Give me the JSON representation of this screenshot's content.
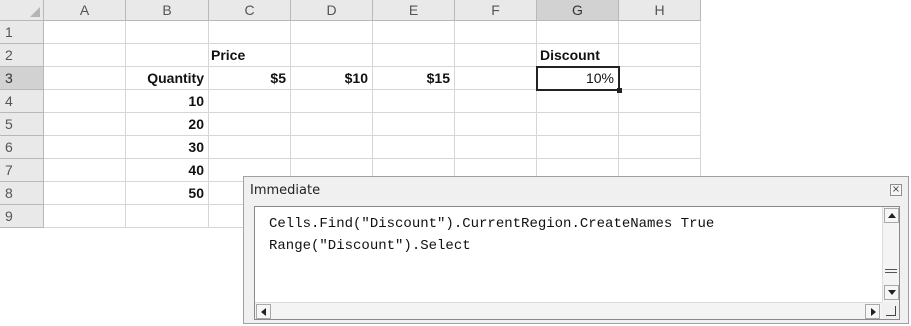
{
  "spreadsheet": {
    "column_headers": [
      "A",
      "B",
      "C",
      "D",
      "E",
      "F",
      "G",
      "H"
    ],
    "row_headers": [
      "1",
      "2",
      "3",
      "4",
      "5",
      "6",
      "7",
      "8",
      "9"
    ],
    "selected_column": "G",
    "selected_row": "3",
    "cells": {
      "C2": "Price",
      "G2": "Discount",
      "B3": "Quantity",
      "C3": "$5",
      "D3": "$10",
      "E3": "$15",
      "G3": "10%",
      "B4": "10",
      "B5": "20",
      "B6": "30",
      "B7": "40",
      "B8": "50"
    }
  },
  "immediate_window": {
    "title": "Immediate",
    "close_icon": "close-icon",
    "code_lines": [
      "Cells.Find(\"Discount\").CurrentRegion.CreateNames True",
      "Range(\"Discount\").Select"
    ]
  }
}
